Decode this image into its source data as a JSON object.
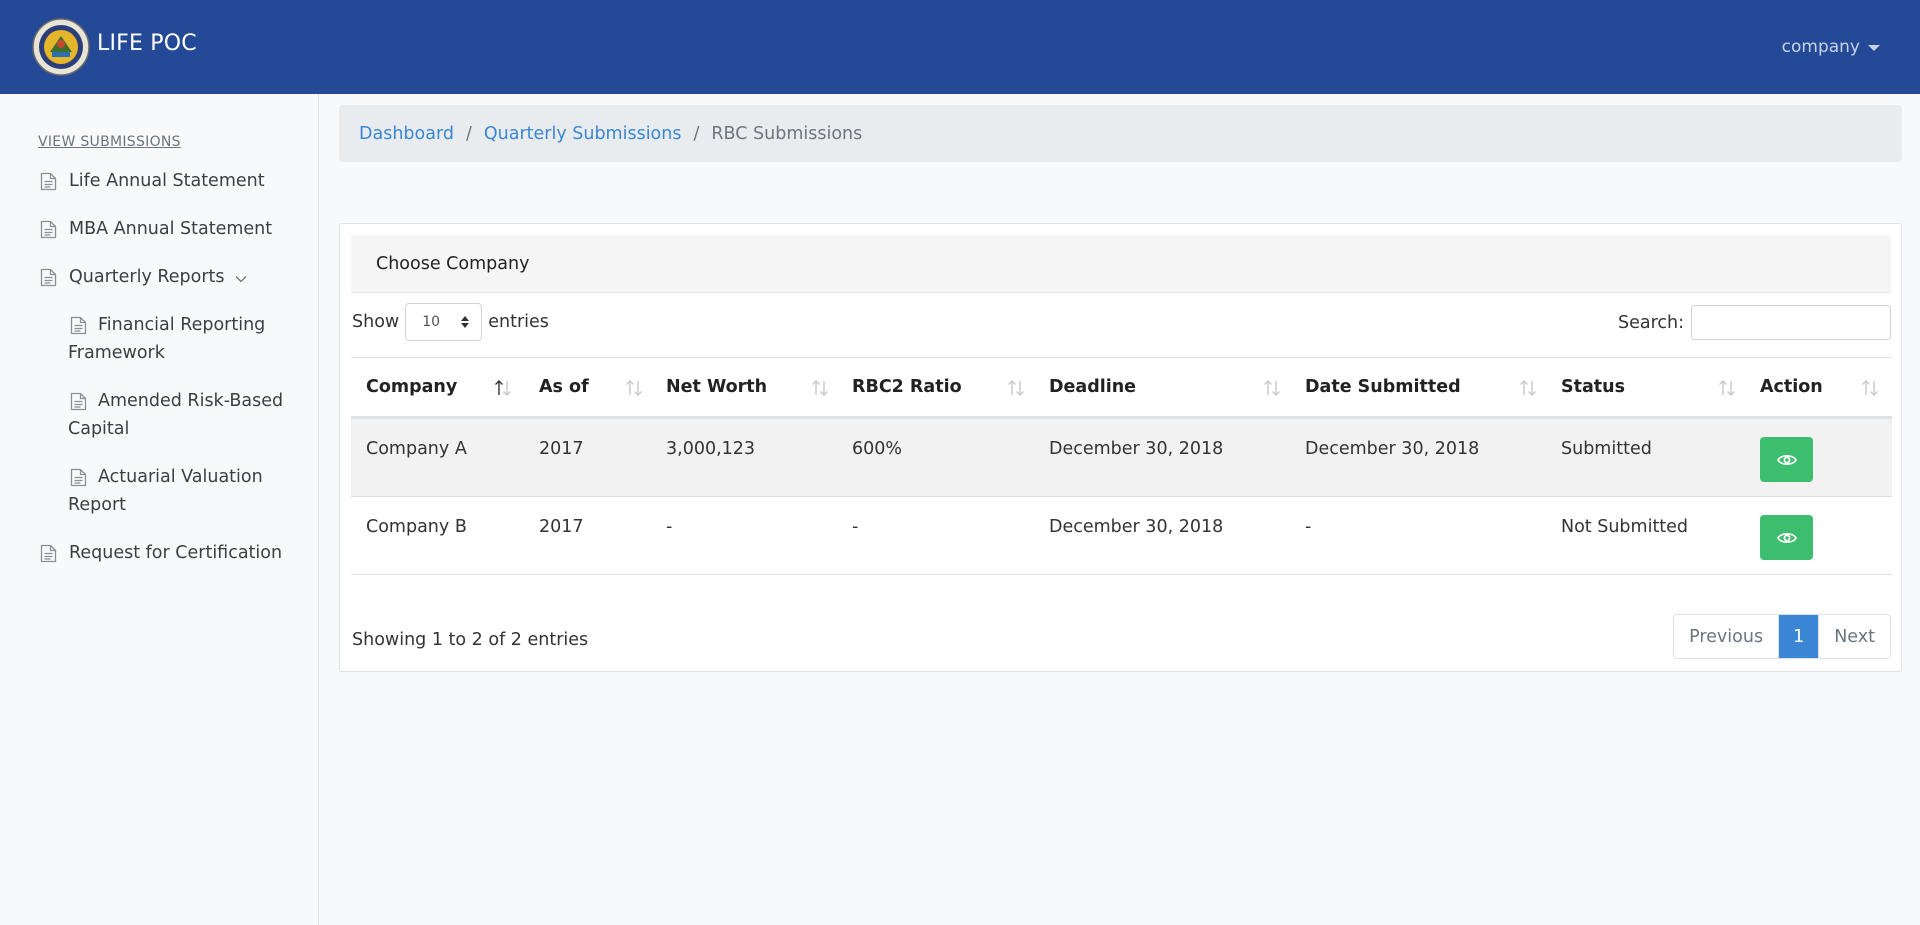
{
  "header": {
    "brand": "LIFE POC",
    "user_menu": "company"
  },
  "sidebar": {
    "heading": "VIEW SUBMISSIONS",
    "items": [
      {
        "label": "Life Annual Statement"
      },
      {
        "label": "MBA Annual Statement"
      },
      {
        "label": "Quarterly Reports"
      },
      {
        "label": "Financial Reporting Framework"
      },
      {
        "label": "Amended Risk-Based Capital"
      },
      {
        "label": "Actuarial Valuation Report"
      },
      {
        "label": "Request for Certification"
      }
    ]
  },
  "breadcrumb": {
    "items": [
      "Dashboard",
      "Quarterly Submissions"
    ],
    "separator": "/",
    "current": "RBC Submissions"
  },
  "card": {
    "title": "Choose Company"
  },
  "table_controls": {
    "show_label": "Show",
    "page_size": "10",
    "entries_label": "entries",
    "search_label": "Search:"
  },
  "table": {
    "columns": [
      "Company",
      "As of",
      "Net Worth",
      "RBC2 Ratio",
      "Deadline",
      "Date Submitted",
      "Status",
      "Action"
    ],
    "rows": [
      {
        "company": "Company A",
        "as_of": "2017",
        "net_worth": "3,000,123",
        "rbc2_ratio": "600%",
        "deadline": "December 30, 2018",
        "date_submitted": "December 30, 2018",
        "status": "Submitted"
      },
      {
        "company": "Company B",
        "as_of": "2017",
        "net_worth": "-",
        "rbc2_ratio": "-",
        "deadline": "December 30, 2018",
        "date_submitted": "-",
        "status": "Not Submitted"
      }
    ]
  },
  "footer": {
    "info": "Showing 1 to 2 of 2 entries",
    "pagination": {
      "previous": "Previous",
      "current": "1",
      "next": "Next"
    }
  },
  "colors": {
    "topbar": "#244a97",
    "link": "#3a86d4",
    "view_button": "#3dbd6e"
  }
}
